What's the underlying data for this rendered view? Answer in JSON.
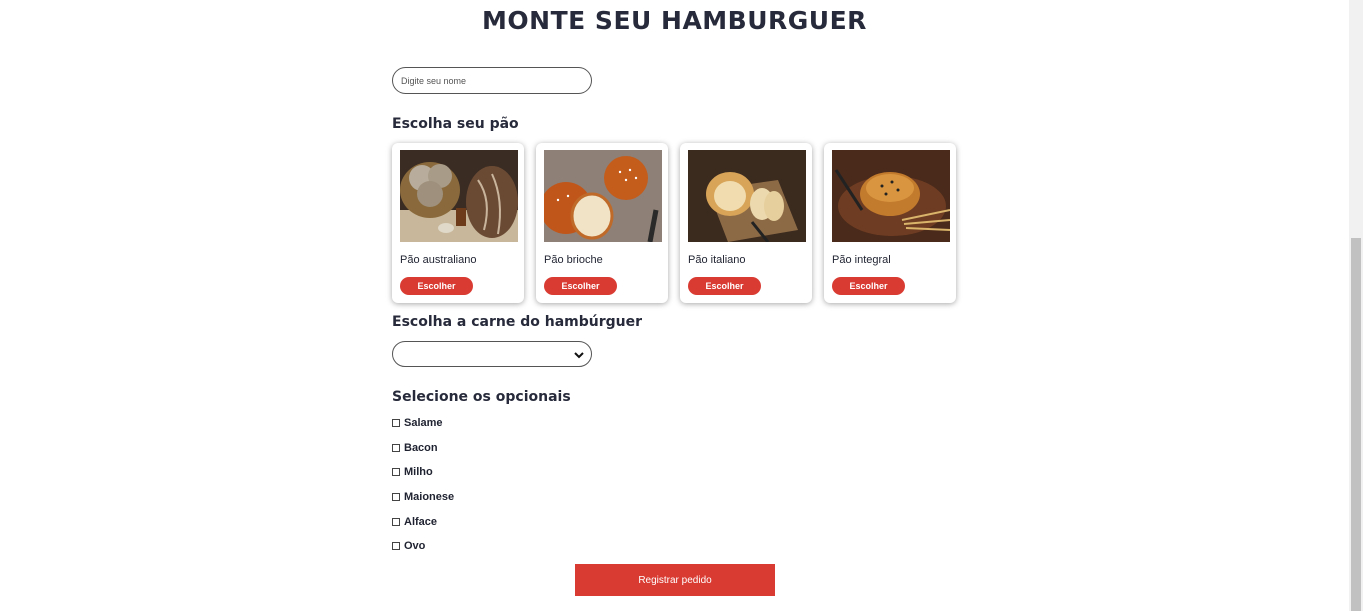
{
  "title": "MONTE SEU HAMBURGUER",
  "name_field": {
    "placeholder": "Digite seu nome",
    "value": ""
  },
  "bread_section": {
    "title": "Escolha seu pão",
    "cards": [
      {
        "name": "Pão australiano",
        "button": "Escolher",
        "image": "australian-bread-photo"
      },
      {
        "name": "Pão brioche",
        "button": "Escolher",
        "image": "brioche-bread-photo"
      },
      {
        "name": "Pão italiano",
        "button": "Escolher",
        "image": "italian-bread-photo"
      },
      {
        "name": "Pão integral",
        "button": "Escolher",
        "image": "wholegrain-bread-photo"
      }
    ]
  },
  "meat_section": {
    "title": "Escolha a carne do hambúrguer",
    "selected": ""
  },
  "optionals_section": {
    "title": "Selecione os opcionais",
    "items": [
      {
        "label": "Salame",
        "checked": false
      },
      {
        "label": "Bacon",
        "checked": false
      },
      {
        "label": "Milho",
        "checked": false
      },
      {
        "label": "Maionese",
        "checked": false
      },
      {
        "label": "Alface",
        "checked": false
      },
      {
        "label": "Ovo",
        "checked": false
      }
    ]
  },
  "submit_button": "Registrar pedido",
  "colors": {
    "accent": "#d93a31",
    "text": "#272a3a",
    "background": "#ffffff"
  },
  "icons": {
    "select_arrow": "chevron-down-icon"
  }
}
